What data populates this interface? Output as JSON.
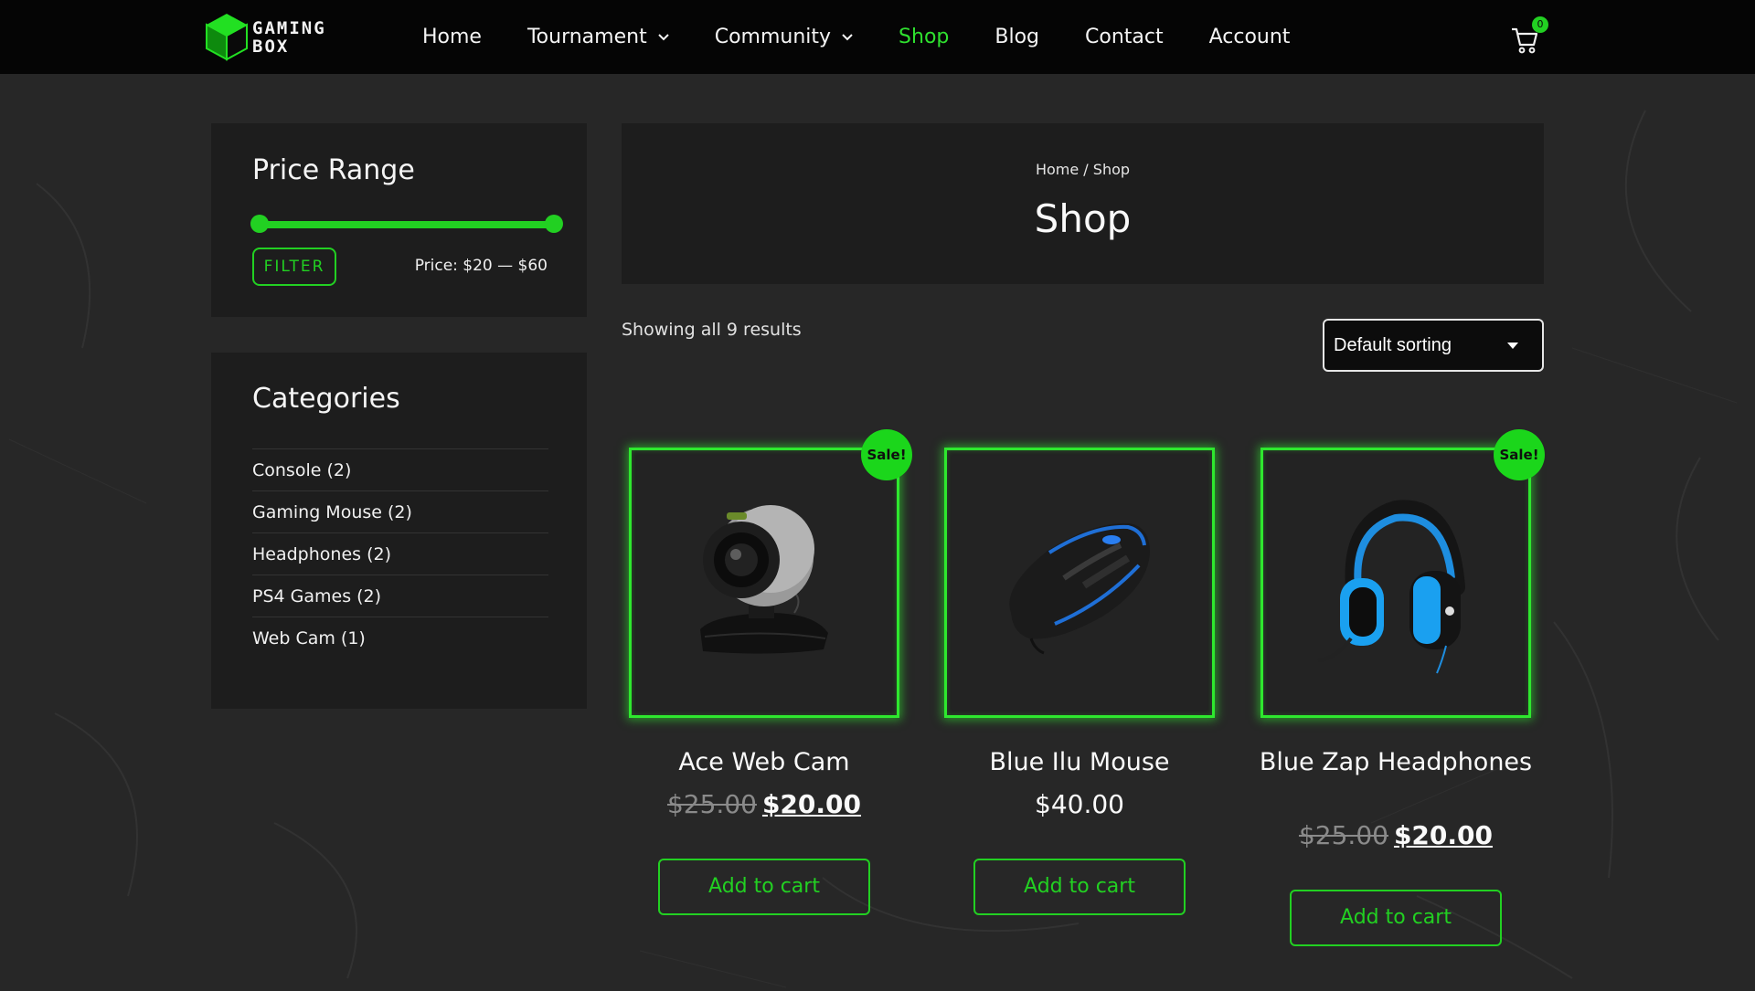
{
  "brand": {
    "line1": "GAMING",
    "line2": "BOX"
  },
  "nav": {
    "items": [
      {
        "label": "Home",
        "dropdown": false,
        "active": false
      },
      {
        "label": "Tournament",
        "dropdown": true,
        "active": false
      },
      {
        "label": "Community",
        "dropdown": true,
        "active": false
      },
      {
        "label": "Shop",
        "dropdown": false,
        "active": true
      },
      {
        "label": "Blog",
        "dropdown": false,
        "active": false
      },
      {
        "label": "Contact",
        "dropdown": false,
        "active": false
      },
      {
        "label": "Account",
        "dropdown": false,
        "active": false
      }
    ],
    "cart_count": "0"
  },
  "price_filter": {
    "title": "Price Range",
    "button": "FILTER",
    "price_label": "Price: $20 — $60",
    "min_fraction": 0.0,
    "max_fraction": 1.0
  },
  "categories": {
    "title": "Categories",
    "items": [
      "Console (2)",
      "Gaming Mouse (2)",
      "Headphones (2)",
      "PS4 Games (2)",
      "Web Cam (1)"
    ]
  },
  "page": {
    "breadcrumb_home": "Home",
    "breadcrumb_sep": " / ",
    "breadcrumb_current": "Shop",
    "title": "Shop",
    "results": "Showing all 9 results",
    "sort": "Default sorting"
  },
  "products": [
    {
      "name": "Ace Web Cam",
      "old_price": "$25.00",
      "price": "$20.00",
      "sale": "Sale!",
      "button": "Add to cart",
      "icon": "webcam-icon"
    },
    {
      "name": "Blue Ilu Mouse",
      "old_price": "",
      "price": "$40.00",
      "sale": "",
      "button": "Add to cart",
      "icon": "mouse-icon"
    },
    {
      "name": "Blue Zap Headphones",
      "old_price": "$25.00",
      "price": "$20.00",
      "sale": "Sale!",
      "button": "Add to cart",
      "icon": "headphones-icon"
    }
  ],
  "colors": {
    "accent": "#22d022",
    "background": "#272727",
    "panel": "#1d1d1d",
    "header": "#050505"
  }
}
